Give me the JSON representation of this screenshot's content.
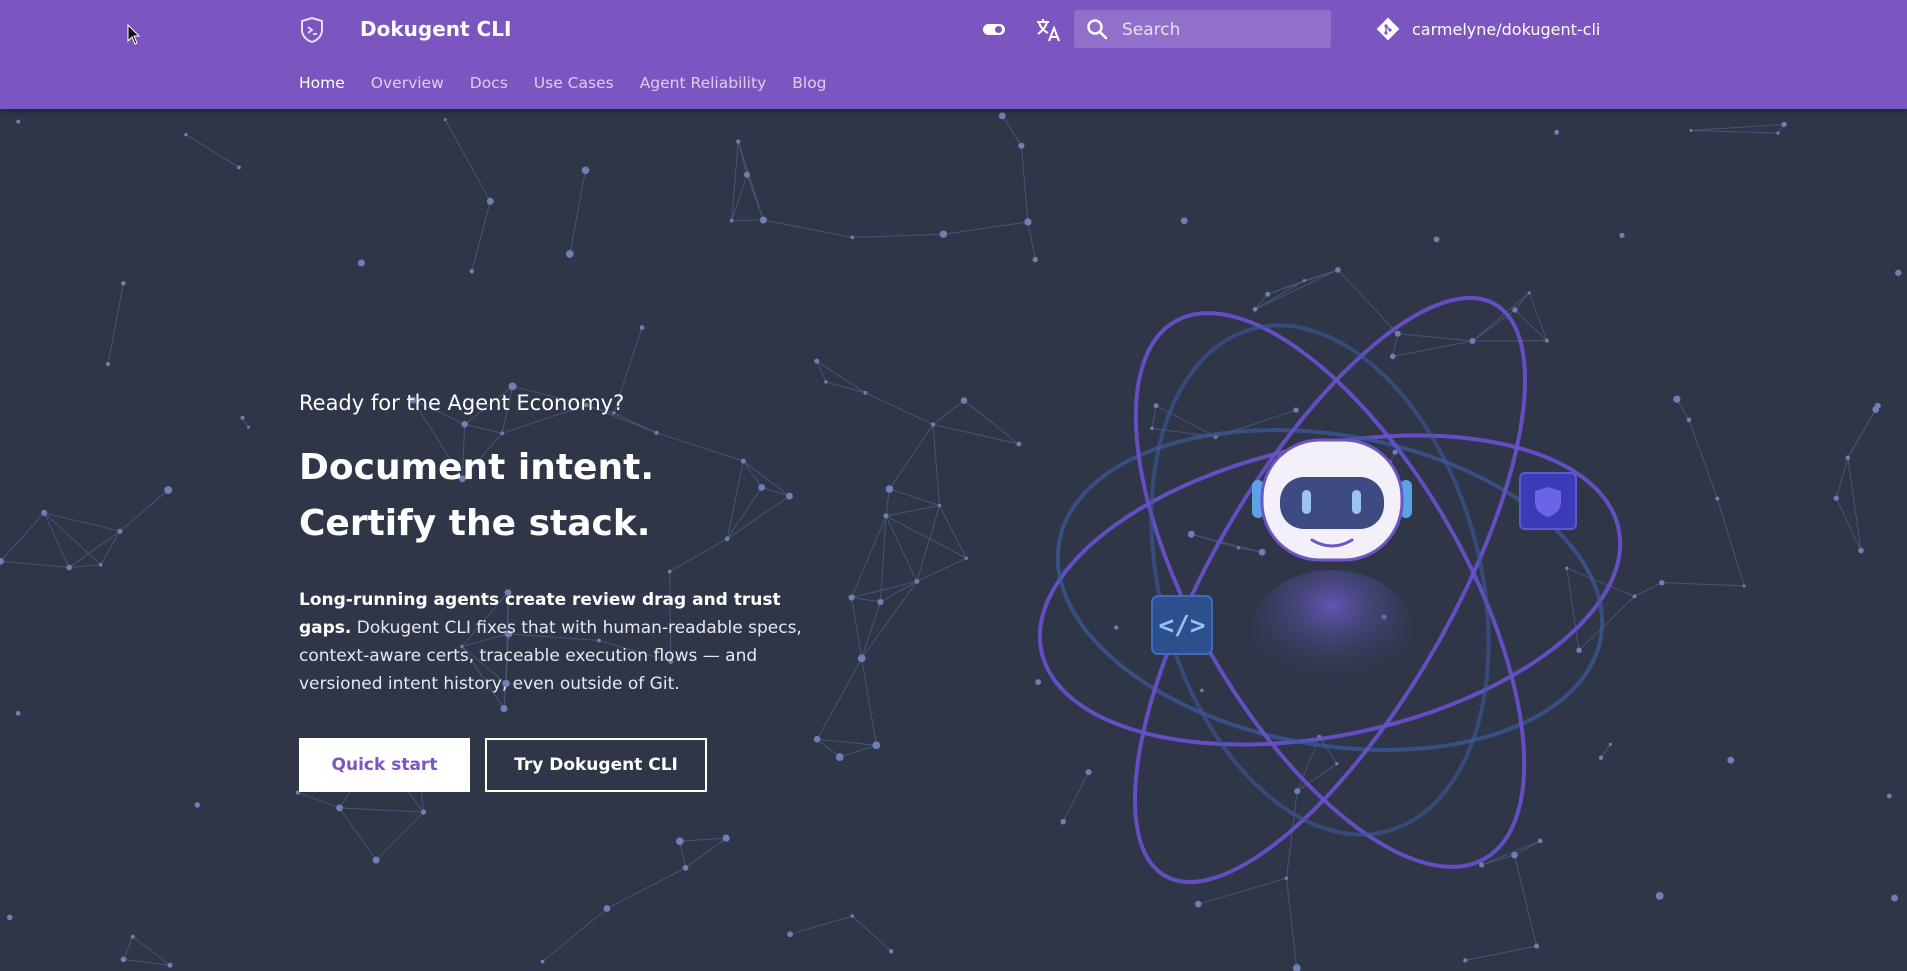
{
  "header": {
    "title": "Dokugent CLI",
    "search": {
      "placeholder": "Search",
      "value": ""
    },
    "repo_label": "carmelyne/dokugent-cli",
    "nav": [
      {
        "label": "Home",
        "active": true
      },
      {
        "label": "Overview",
        "active": false
      },
      {
        "label": "Docs",
        "active": false
      },
      {
        "label": "Use Cases",
        "active": false
      },
      {
        "label": "Agent Reliability",
        "active": false
      },
      {
        "label": "Blog",
        "active": false
      }
    ]
  },
  "hero": {
    "eyebrow": "Ready for the Agent Economy?",
    "headline_line1": "Document intent.",
    "headline_line2": "Certify the stack.",
    "desc_bold": "Long-running agents create review drag and trust gaps.",
    "desc_rest": "Dokugent CLI fixes that with human-readable specs, context-aware certs, traceable execution flows — and versioned intent history, even outside of Git.",
    "primary_button": "Quick start",
    "secondary_button": "Try Dokugent CLI"
  },
  "icons": {
    "logo": "shield-logo-icon",
    "theme_toggle": "toggle-icon",
    "language": "translate-icon",
    "search": "search-icon",
    "repo": "git-icon",
    "code_badge": "code-icon",
    "shield_badge": "shield-icon",
    "robot": "robot-icon",
    "cursor": "mouse-cursor-icon"
  },
  "colors": {
    "header_bg": "#7b55c0",
    "page_bg": "#2e3648",
    "accent": "#7b55c0",
    "orbit": "#6a4fd0",
    "particle": "#6f7fb3"
  }
}
